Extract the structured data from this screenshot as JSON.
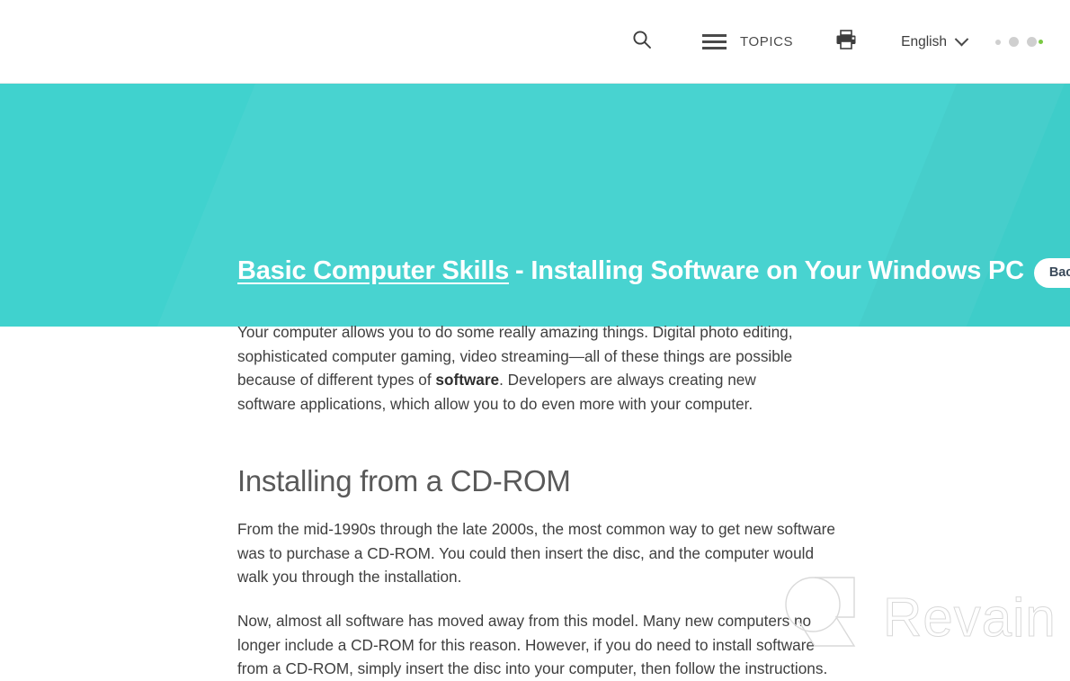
{
  "topbar": {
    "search_icon": "search-icon",
    "menu_icon": "hamburger-menu-icon",
    "topics_label": "TOPICS",
    "print_icon": "printer-icon",
    "language_label": "English",
    "language_chevron": "chevron-down-icon",
    "dots": [
      "dot-small",
      "dot-medium",
      "dot-large",
      "dot-green-accent"
    ]
  },
  "banner": {
    "background_color": "#40d2ce",
    "title_link": "Basic Computer Skills",
    "title_separator": "-",
    "title_rest": "Installing Software on Your Windows PC",
    "back_button_label": "Back to Tutorial",
    "back_button_bg": "#ffffff",
    "back_button_text_color": "#3b4a5a"
  },
  "article": {
    "paragraph_1_part_1": "Your computer allows you to do some really amazing things. Digital photo editing, sophisticated computer gaming, video streaming—all of these things are possible because of different types of ",
    "paragraph_1_bold": "software",
    "paragraph_1_part_2": ". Developers are always creating new software applications, which allow you to do even more with your computer.",
    "heading_2": "Installing from a CD-ROM",
    "paragraph_2": "From the mid-1990s through the late 2000s, the most common way to get new software was to purchase a CD-ROM. You could then insert the disc, and the computer would walk you through the installation.",
    "paragraph_3": "Now, almost all software has moved away from this model. Many new computers no longer include a CD-ROM for this reason. However, if you do need to install software from a CD-ROM, simply insert the disc into your computer, then follow the instructions."
  },
  "watermark": {
    "text": "Revain",
    "logo_icon": "revain-logo-icon",
    "stroke_color": "#d9d9d9"
  }
}
